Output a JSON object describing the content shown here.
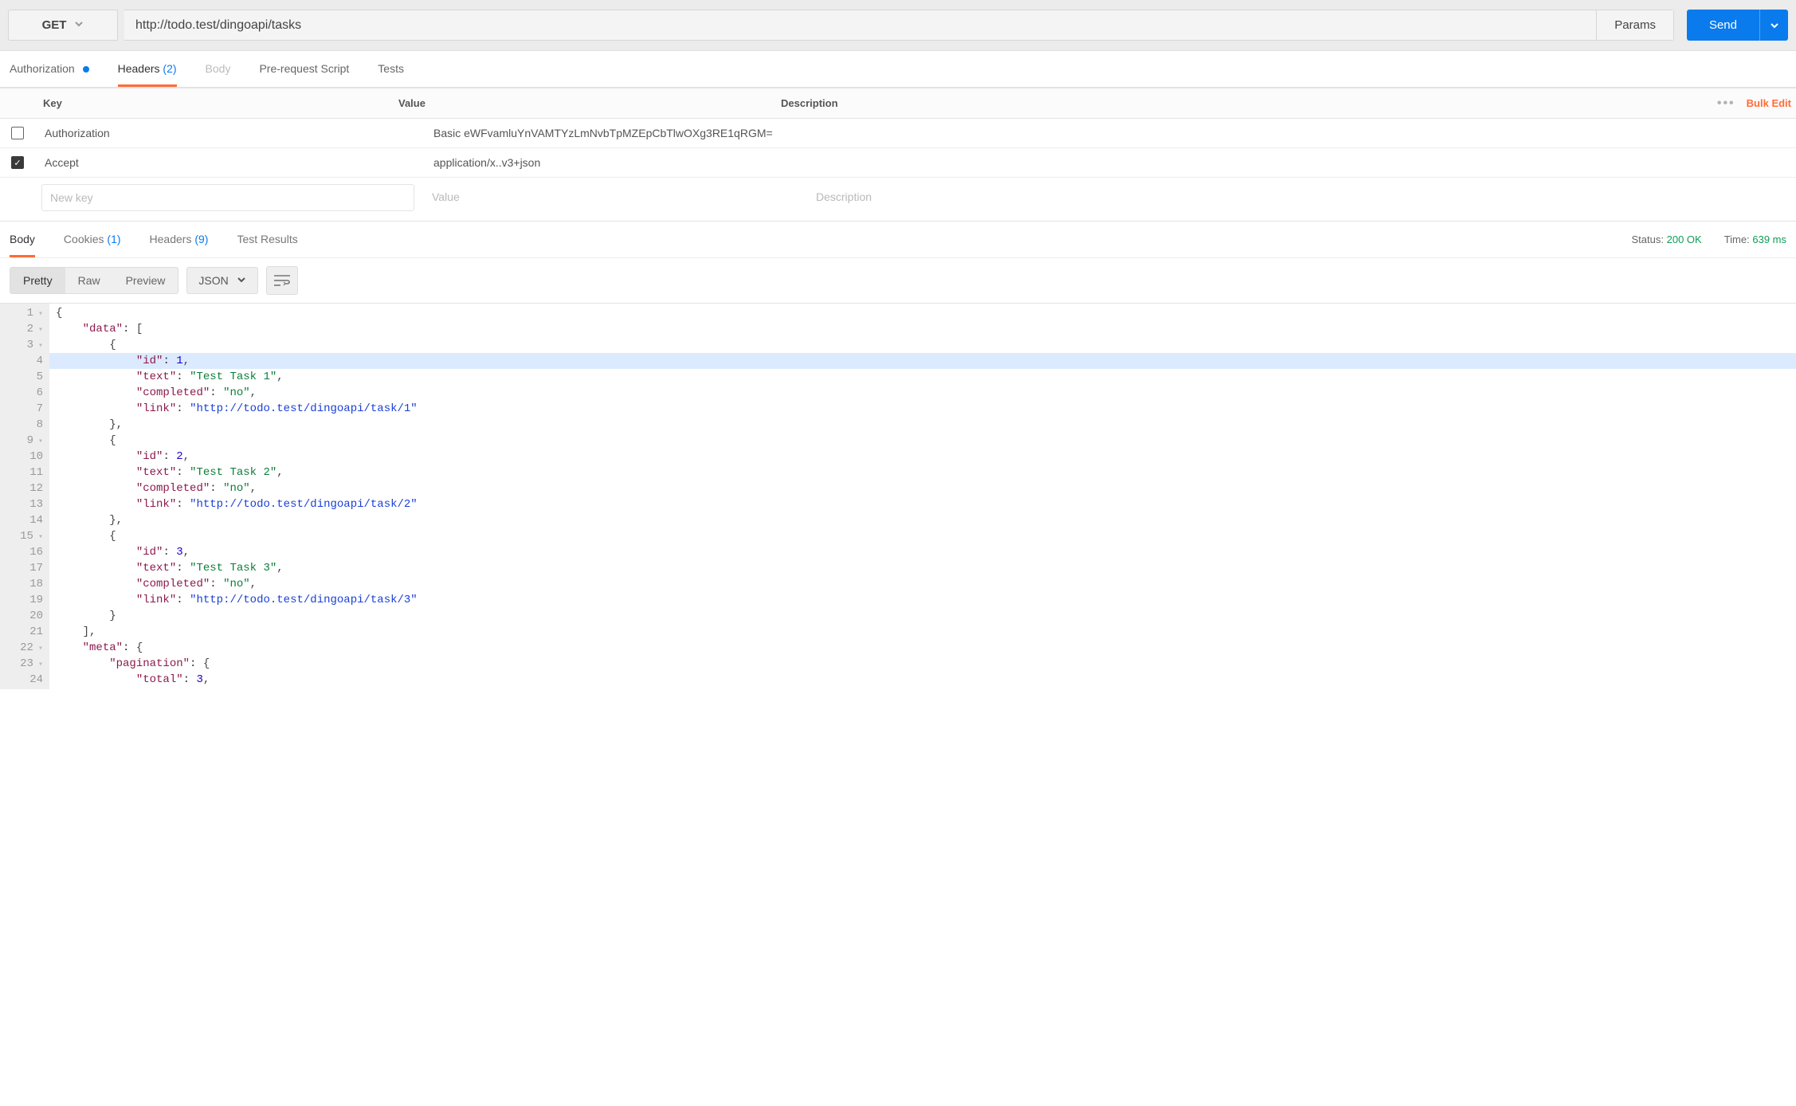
{
  "request": {
    "method": "GET",
    "url": "http://todo.test/dingoapi/tasks",
    "params_label": "Params",
    "send_label": "Send"
  },
  "request_tabs": {
    "authorization": "Authorization",
    "headers": "Headers",
    "headers_count": "(2)",
    "body": "Body",
    "prerequest": "Pre-request Script",
    "tests": "Tests"
  },
  "headers_table": {
    "head_key": "Key",
    "head_value": "Value",
    "head_desc": "Description",
    "bulk_edit": "Bulk Edit",
    "rows": [
      {
        "checked": false,
        "key": "Authorization",
        "value": "Basic eWFvamluYnVAMTYzLmNvbTpMZEpCbTlwOXg3RE1qRGM="
      },
      {
        "checked": true,
        "key": "Accept",
        "value": "application/x..v3+json"
      }
    ],
    "placeholders": {
      "key": "New key",
      "value": "Value",
      "desc": "Description"
    }
  },
  "response_tabs": {
    "body": "Body",
    "cookies": "Cookies",
    "cookies_count": "(1)",
    "headers": "Headers",
    "headers_count": "(9)",
    "tests": "Test Results"
  },
  "response_meta": {
    "status_label": "Status:",
    "status_value": "200 OK",
    "time_label": "Time:",
    "time_value": "639 ms"
  },
  "body_toolbar": {
    "pretty": "Pretty",
    "raw": "Raw",
    "preview": "Preview",
    "format": "JSON"
  },
  "code_lines": [
    {
      "n": "1",
      "fold": true,
      "indent": 0,
      "tokens": [
        {
          "t": "{",
          "c": "brace"
        }
      ]
    },
    {
      "n": "2",
      "fold": true,
      "indent": 1,
      "tokens": [
        {
          "t": "\"data\"",
          "c": "key"
        },
        {
          "t": ": ",
          "c": ""
        },
        {
          "t": "[",
          "c": "bracket"
        }
      ]
    },
    {
      "n": "3",
      "fold": true,
      "indent": 2,
      "tokens": [
        {
          "t": "{",
          "c": "brace"
        }
      ]
    },
    {
      "n": "4",
      "hl": true,
      "indent": 3,
      "tokens": [
        {
          "t": "\"id\"",
          "c": "key"
        },
        {
          "t": ": ",
          "c": ""
        },
        {
          "t": "1",
          "c": "num"
        },
        {
          "t": ",",
          "c": "comma"
        }
      ]
    },
    {
      "n": "5",
      "indent": 3,
      "tokens": [
        {
          "t": "\"text\"",
          "c": "key"
        },
        {
          "t": ": ",
          "c": ""
        },
        {
          "t": "\"Test Task 1\"",
          "c": "str"
        },
        {
          "t": ",",
          "c": "comma"
        }
      ]
    },
    {
      "n": "6",
      "indent": 3,
      "tokens": [
        {
          "t": "\"completed\"",
          "c": "key"
        },
        {
          "t": ": ",
          "c": ""
        },
        {
          "t": "\"no\"",
          "c": "str"
        },
        {
          "t": ",",
          "c": "comma"
        }
      ]
    },
    {
      "n": "7",
      "indent": 3,
      "tokens": [
        {
          "t": "\"link\"",
          "c": "key"
        },
        {
          "t": ": ",
          "c": ""
        },
        {
          "t": "\"http://todo.test/dingoapi/task/1\"",
          "c": "link"
        }
      ]
    },
    {
      "n": "8",
      "indent": 2,
      "tokens": [
        {
          "t": "}",
          "c": "brace"
        },
        {
          "t": ",",
          "c": "comma"
        }
      ]
    },
    {
      "n": "9",
      "fold": true,
      "indent": 2,
      "tokens": [
        {
          "t": "{",
          "c": "brace"
        }
      ]
    },
    {
      "n": "10",
      "indent": 3,
      "tokens": [
        {
          "t": "\"id\"",
          "c": "key"
        },
        {
          "t": ": ",
          "c": ""
        },
        {
          "t": "2",
          "c": "num"
        },
        {
          "t": ",",
          "c": "comma"
        }
      ]
    },
    {
      "n": "11",
      "indent": 3,
      "tokens": [
        {
          "t": "\"text\"",
          "c": "key"
        },
        {
          "t": ": ",
          "c": ""
        },
        {
          "t": "\"Test Task 2\"",
          "c": "str"
        },
        {
          "t": ",",
          "c": "comma"
        }
      ]
    },
    {
      "n": "12",
      "indent": 3,
      "tokens": [
        {
          "t": "\"completed\"",
          "c": "key"
        },
        {
          "t": ": ",
          "c": ""
        },
        {
          "t": "\"no\"",
          "c": "str"
        },
        {
          "t": ",",
          "c": "comma"
        }
      ]
    },
    {
      "n": "13",
      "indent": 3,
      "tokens": [
        {
          "t": "\"link\"",
          "c": "key"
        },
        {
          "t": ": ",
          "c": ""
        },
        {
          "t": "\"http://todo.test/dingoapi/task/2\"",
          "c": "link"
        }
      ]
    },
    {
      "n": "14",
      "indent": 2,
      "tokens": [
        {
          "t": "}",
          "c": "brace"
        },
        {
          "t": ",",
          "c": "comma"
        }
      ]
    },
    {
      "n": "15",
      "fold": true,
      "indent": 2,
      "tokens": [
        {
          "t": "{",
          "c": "brace"
        }
      ]
    },
    {
      "n": "16",
      "indent": 3,
      "tokens": [
        {
          "t": "\"id\"",
          "c": "key"
        },
        {
          "t": ": ",
          "c": ""
        },
        {
          "t": "3",
          "c": "num"
        },
        {
          "t": ",",
          "c": "comma"
        }
      ]
    },
    {
      "n": "17",
      "indent": 3,
      "tokens": [
        {
          "t": "\"text\"",
          "c": "key"
        },
        {
          "t": ": ",
          "c": ""
        },
        {
          "t": "\"Test Task 3\"",
          "c": "str"
        },
        {
          "t": ",",
          "c": "comma"
        }
      ]
    },
    {
      "n": "18",
      "indent": 3,
      "tokens": [
        {
          "t": "\"completed\"",
          "c": "key"
        },
        {
          "t": ": ",
          "c": ""
        },
        {
          "t": "\"no\"",
          "c": "str"
        },
        {
          "t": ",",
          "c": "comma"
        }
      ]
    },
    {
      "n": "19",
      "indent": 3,
      "tokens": [
        {
          "t": "\"link\"",
          "c": "key"
        },
        {
          "t": ": ",
          "c": ""
        },
        {
          "t": "\"http://todo.test/dingoapi/task/3\"",
          "c": "link"
        }
      ]
    },
    {
      "n": "20",
      "indent": 2,
      "tokens": [
        {
          "t": "}",
          "c": "brace"
        }
      ]
    },
    {
      "n": "21",
      "indent": 1,
      "tokens": [
        {
          "t": "]",
          "c": "bracket"
        },
        {
          "t": ",",
          "c": "comma"
        }
      ]
    },
    {
      "n": "22",
      "fold": true,
      "indent": 1,
      "tokens": [
        {
          "t": "\"meta\"",
          "c": "key"
        },
        {
          "t": ": ",
          "c": ""
        },
        {
          "t": "{",
          "c": "brace"
        }
      ]
    },
    {
      "n": "23",
      "fold": true,
      "indent": 2,
      "tokens": [
        {
          "t": "\"pagination\"",
          "c": "key"
        },
        {
          "t": ": ",
          "c": ""
        },
        {
          "t": "{",
          "c": "brace"
        }
      ]
    },
    {
      "n": "24",
      "indent": 3,
      "tokens": [
        {
          "t": "\"total\"",
          "c": "key"
        },
        {
          "t": ": ",
          "c": ""
        },
        {
          "t": "3",
          "c": "num"
        },
        {
          "t": ",",
          "c": "comma"
        }
      ]
    }
  ]
}
